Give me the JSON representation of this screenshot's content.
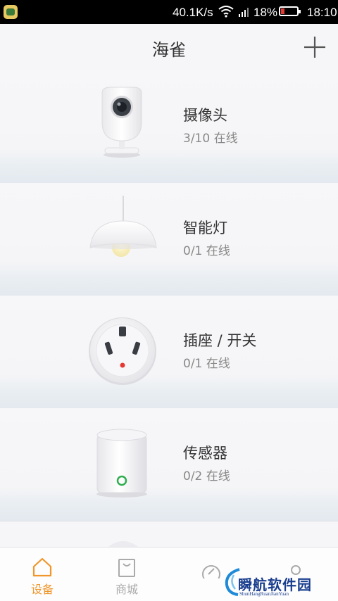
{
  "status_bar": {
    "net_speed": "40.1K/s",
    "battery_percent": "18%",
    "time": "18:10"
  },
  "header": {
    "title": "海雀",
    "add_icon": "plus-icon"
  },
  "devices": [
    {
      "name": "摄像头",
      "status": "3/10 在线",
      "icon": "camera-icon"
    },
    {
      "name": "智能灯",
      "status": "0/1 在线",
      "icon": "lamp-icon"
    },
    {
      "name": "插座 / 开关",
      "status": "0/1 在线",
      "icon": "socket-icon"
    },
    {
      "name": "传感器",
      "status": "0/2 在线",
      "icon": "sensor-icon"
    }
  ],
  "tabbar": {
    "items": [
      {
        "label": "设备",
        "icon": "home-icon",
        "active": true
      },
      {
        "label": "商城",
        "icon": "shopping-bag-icon",
        "active": false
      },
      {
        "label": "",
        "icon": "compass-icon",
        "active": false
      },
      {
        "label": "",
        "icon": "user-icon",
        "active": false
      }
    ]
  },
  "watermark": {
    "text": "瞬航软件园",
    "subtext": "ShunHangRuanJianYuan"
  },
  "colors": {
    "accent": "#f0962a",
    "inactive": "#aaaaaa",
    "background": "#f2f2f4",
    "status_bar": "#000000"
  }
}
